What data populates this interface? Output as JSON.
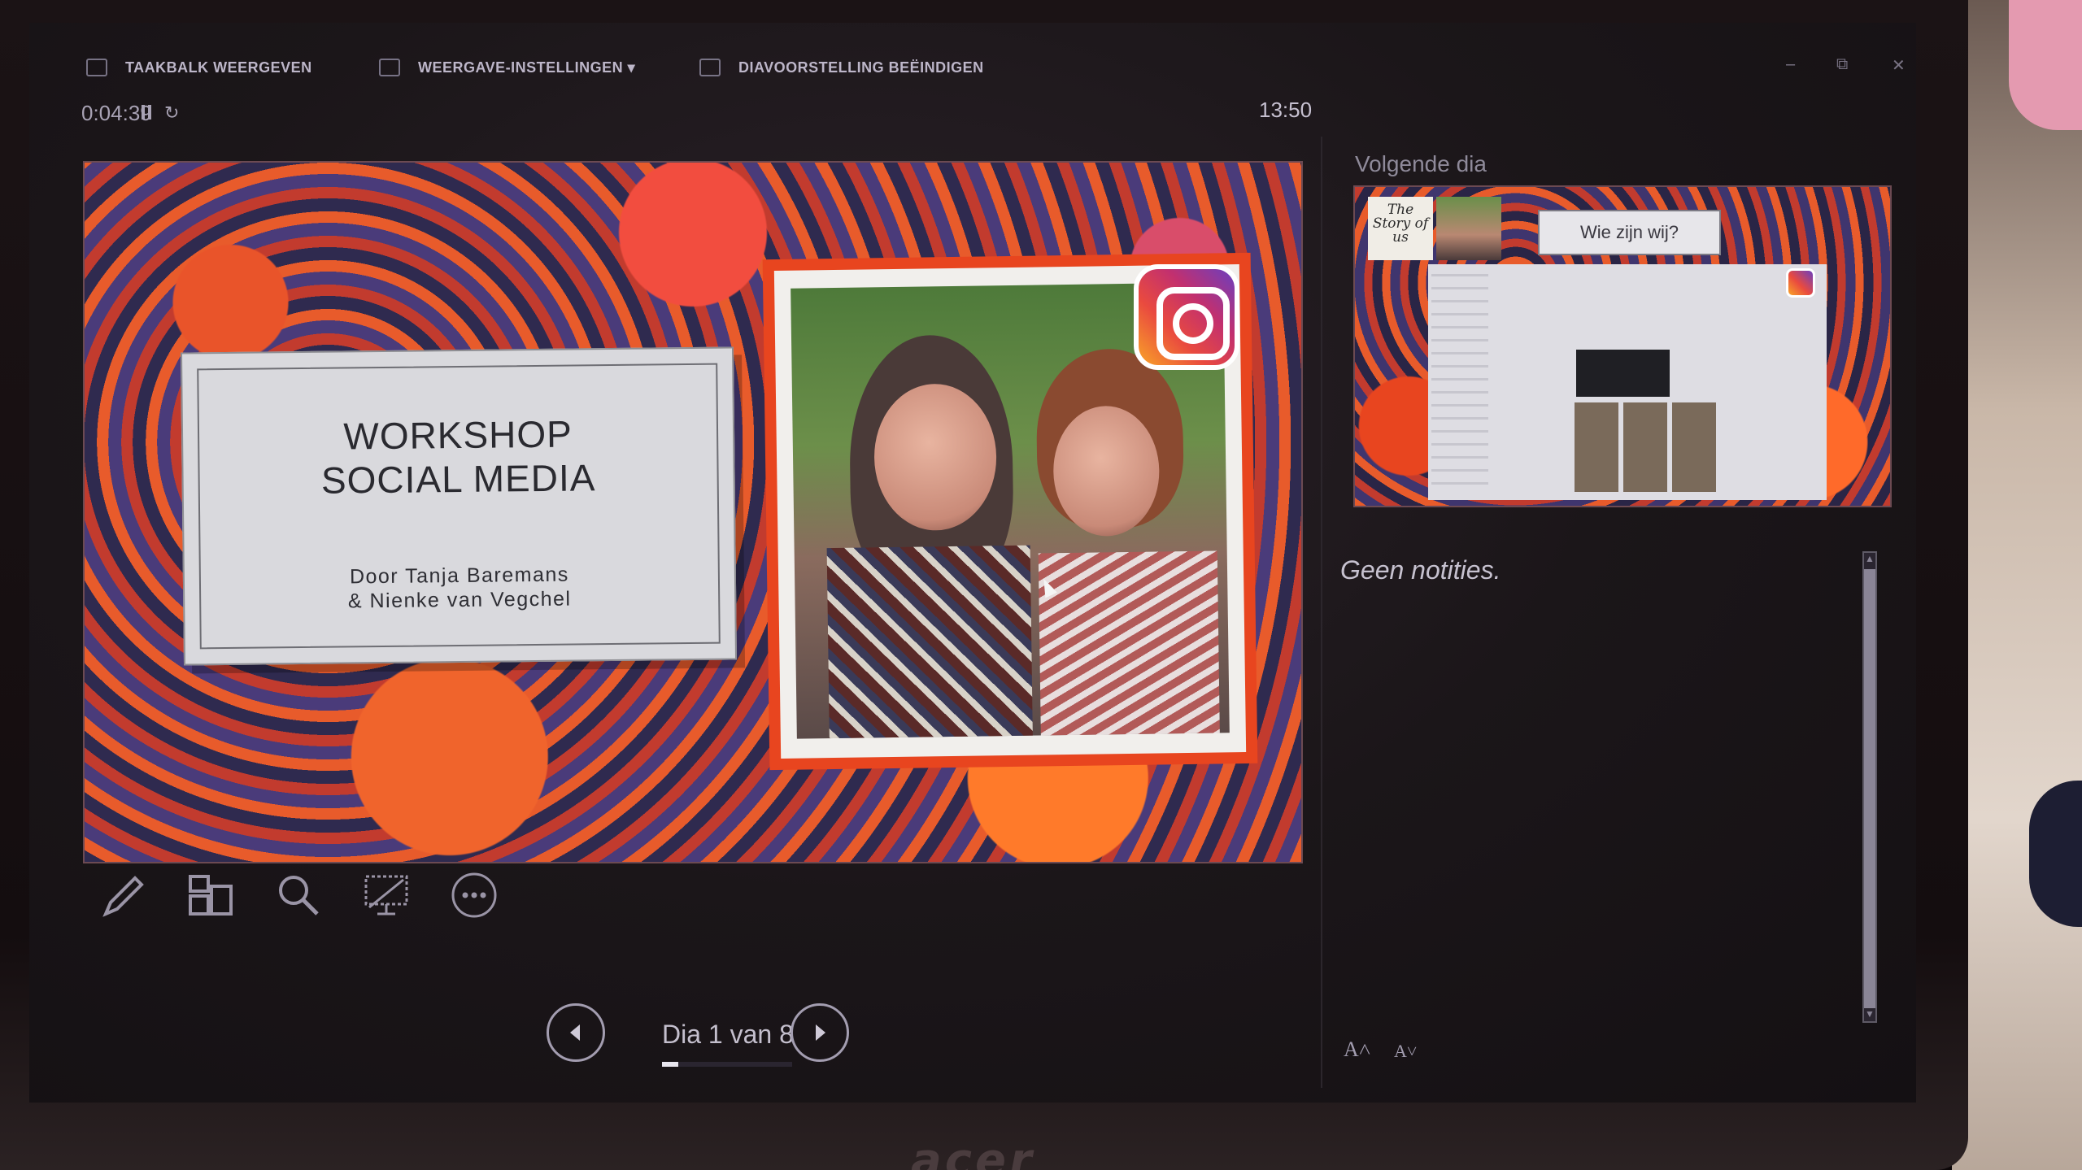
{
  "toolbar": {
    "show_taskbar": "TAAKBALK WEERGEVEN",
    "display_settings": "WEERGAVE-INSTELLINGEN ▾",
    "end_slideshow": "DIAVOORSTELLING BEËINDIGEN"
  },
  "window_controls": {
    "minimize": "–",
    "restore": "⧉",
    "close": "✕"
  },
  "timer": {
    "elapsed": "0:04:39",
    "clock": "13:50"
  },
  "current_slide": {
    "title": "WORKSHOP\nSOCIAL MEDIA",
    "author_line_1": "Door Tanja Baremans",
    "author_line_2": "& Nienke van Vegchel"
  },
  "tools": [
    {
      "icon": "pen-icon"
    },
    {
      "icon": "see-all-slides-icon"
    },
    {
      "icon": "zoom-icon"
    },
    {
      "icon": "black-screen-icon"
    },
    {
      "icon": "more-options-icon"
    }
  ],
  "navigation": {
    "previous_icon": "chevron-left-icon",
    "next_icon": "chevron-right-icon",
    "counter": "Dia 1 van 8",
    "current": 1,
    "total": 8
  },
  "next_slide": {
    "label": "Volgende dia",
    "title": "Wie zijn wij?",
    "logo_text": "The Story of us"
  },
  "notes": {
    "text": "Geen notities.",
    "font_increase": "A˄",
    "font_decrease": "A˅"
  },
  "device": {
    "brand": "acer"
  },
  "colors": {
    "accent_orange": "#e8451f",
    "ui_text": "#b8b3c2",
    "instagram_gradient_start": "#f9a428",
    "instagram_gradient_end": "#6b3fbf"
  }
}
